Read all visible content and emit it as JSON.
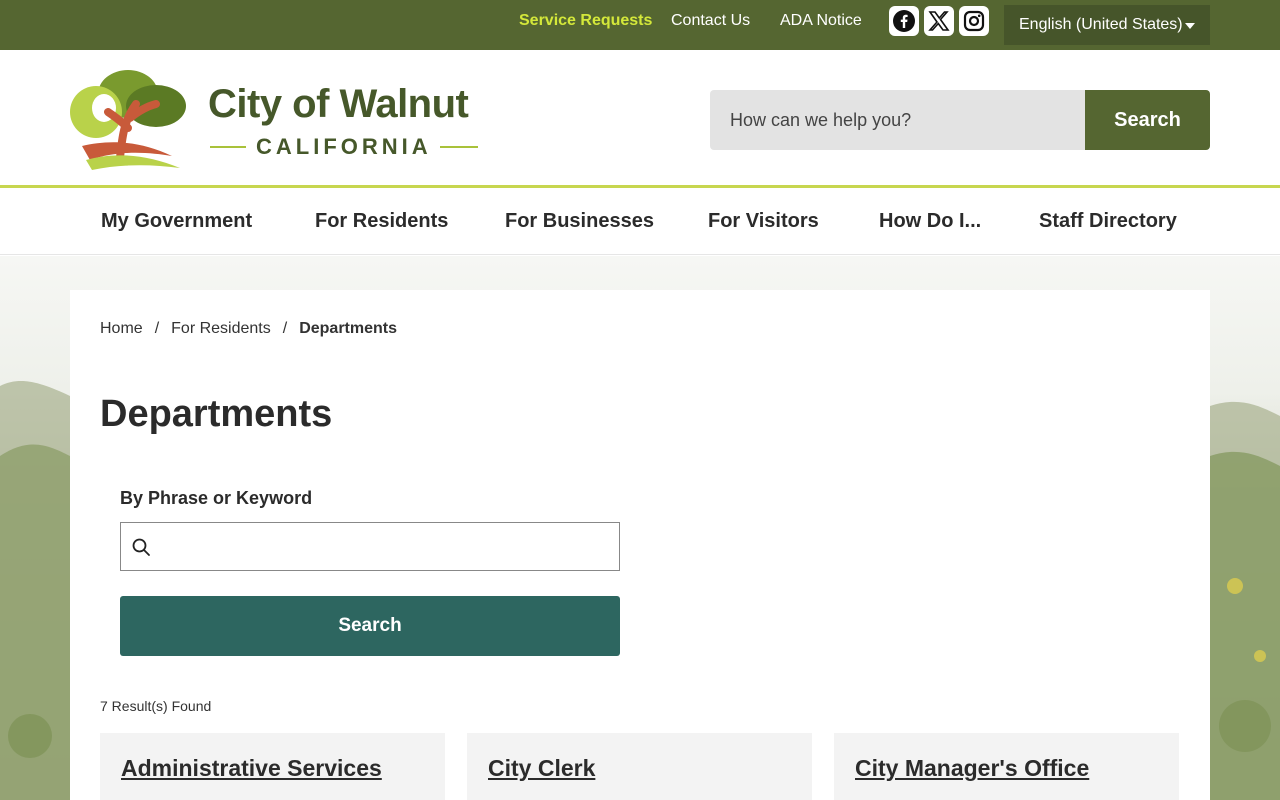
{
  "topbar": {
    "links": [
      {
        "label": "Service Requests"
      },
      {
        "label": "Contact Us"
      },
      {
        "label": "ADA Notice"
      }
    ],
    "social": [
      {
        "icon": "facebook-icon"
      },
      {
        "icon": "x-twitter-icon"
      },
      {
        "icon": "instagram-icon"
      }
    ],
    "language": "English (United States)",
    "colors": {
      "bar": "#556631",
      "accent_link": "#d4e83a"
    }
  },
  "header": {
    "logo_title": "City of Walnut",
    "logo_subtitle": "CALIFORNIA",
    "search_placeholder": "How can we help you?",
    "search_button": "Search"
  },
  "nav": {
    "items": [
      {
        "label": "My Government"
      },
      {
        "label": "For Residents"
      },
      {
        "label": "For Businesses"
      },
      {
        "label": "For Visitors"
      },
      {
        "label": "How Do I..."
      },
      {
        "label": "Staff Directory"
      }
    ]
  },
  "breadcrumb": {
    "items": [
      {
        "label": "Home"
      },
      {
        "label": "For Residents"
      },
      {
        "label": "Departments"
      }
    ],
    "separator": "/"
  },
  "main": {
    "title": "Departments",
    "filter_label": "By Phrase or Keyword",
    "keyword_value": "",
    "search_button": "Search",
    "results_text": "7 Result(s) Found",
    "cards": [
      {
        "title": "Administrative Services"
      },
      {
        "title": "City Clerk"
      },
      {
        "title": "City Manager's Office"
      }
    ],
    "colors": {
      "search_button": "#2d6660"
    }
  }
}
